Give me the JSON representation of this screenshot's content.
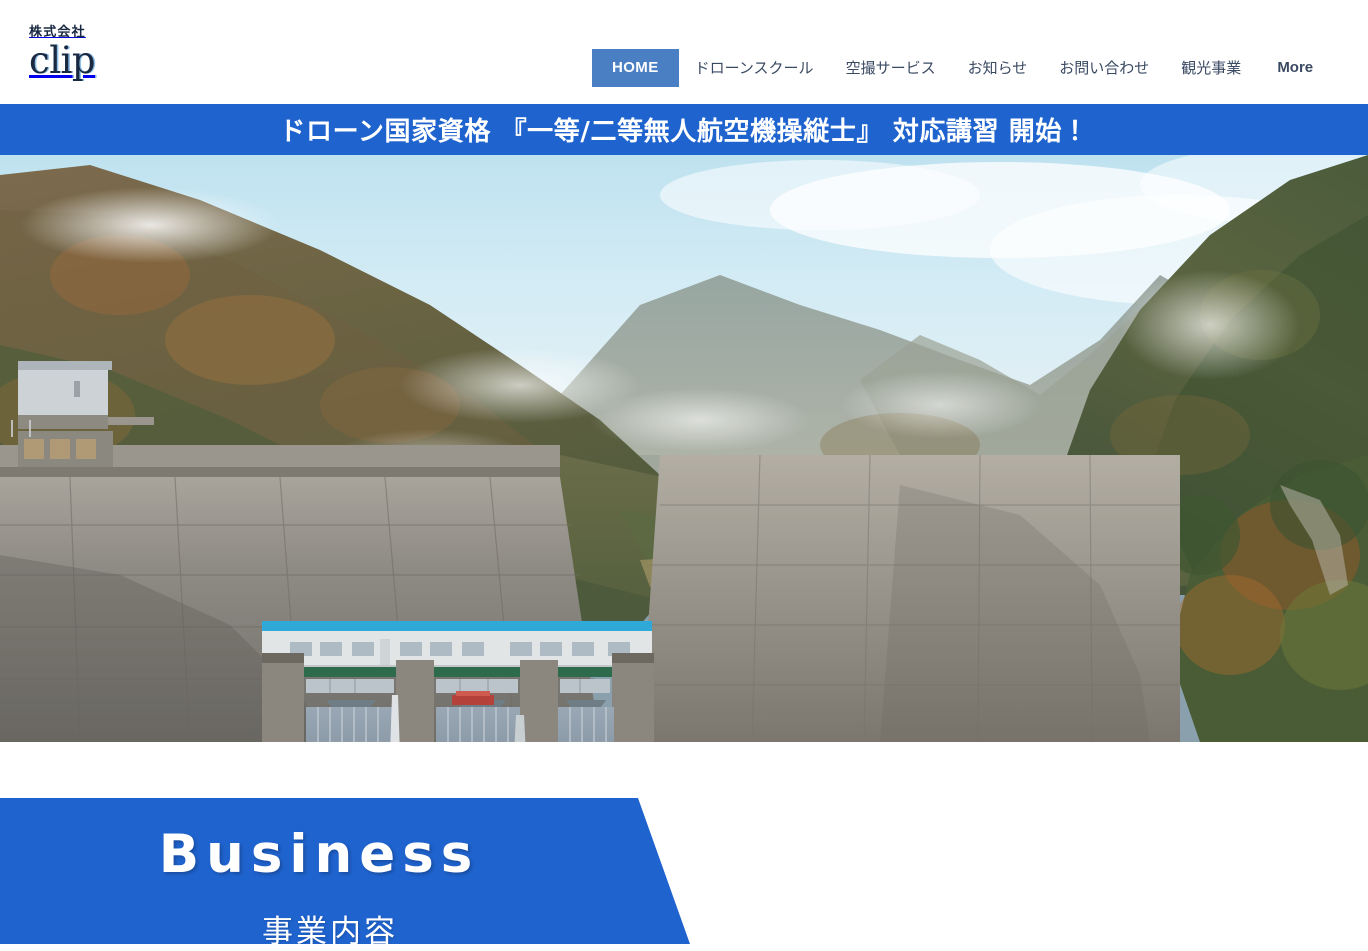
{
  "site": {
    "logo_kana": "株式会社",
    "logo_name": "clip"
  },
  "nav": {
    "items": [
      {
        "label": "HOME",
        "active": true
      },
      {
        "label": "ドローンスクール",
        "active": false
      },
      {
        "label": "空撮サービス",
        "active": false
      },
      {
        "label": "お知らせ",
        "active": false
      },
      {
        "label": "お問い合わせ",
        "active": false
      },
      {
        "label": "観光事業",
        "active": false
      },
      {
        "label": "More",
        "active": false
      }
    ]
  },
  "banner": {
    "text": "ドローン国家資格 『一等/二等無人航空機操縦士』 対応講習 開始！"
  },
  "hero": {
    "alt": "紅葉の山間にあるコンクリートダムの空撮"
  },
  "business": {
    "title_en": "Business",
    "title_jp": "事業内容"
  },
  "colors": {
    "brand_blue": "#1f63ce",
    "button_blue": "#4a7fc4",
    "logo_navy": "#1a2942",
    "nav_text": "#3b4a63",
    "white": "#ffffff"
  }
}
